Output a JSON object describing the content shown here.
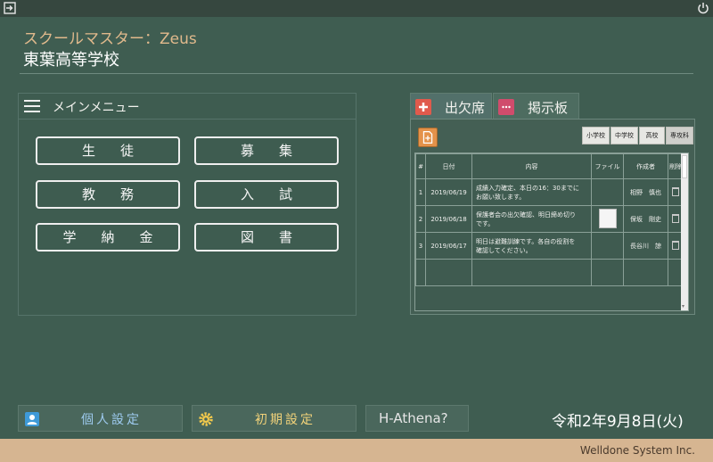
{
  "header": {
    "app_title": "スクールマスター：Zeus",
    "school_name": "東葉高等学校"
  },
  "main_menu": {
    "title": "メインメニュー",
    "buttons": [
      "生徒",
      "募集",
      "教務",
      "入試",
      "学納金",
      "図書"
    ]
  },
  "tabs": [
    {
      "label": "出欠席",
      "icon": "plus-icon",
      "color": "#e05a4c"
    },
    {
      "label": "掲示板",
      "icon": "chat-icon",
      "color": "#d04c6c"
    }
  ],
  "attendance": {
    "school_tabs": [
      "小学校",
      "中学校",
      "高校",
      "専攻科"
    ],
    "selected_tab": "専攻科",
    "columns": [
      "#",
      "日付",
      "内容",
      "ファイル",
      "作成者",
      "削除"
    ],
    "rows": [
      {
        "no": "1",
        "date": "2019/06/19",
        "content_line1": "成績入力確定、本日の16：30までに",
        "content_line2": "お願い致します。",
        "has_file": false,
        "author": "相野　慎也"
      },
      {
        "no": "2",
        "date": "2019/06/18",
        "content_line1": "保護者会の出欠確認、明日締め切り",
        "content_line2": "です。",
        "has_file": true,
        "author": "保坂　剛史"
      },
      {
        "no": "3",
        "date": "2019/06/17",
        "content_line1": "明日は避難訓練です。各自の役割を",
        "content_line2": "確認してください。",
        "has_file": false,
        "author": "長谷川　諒"
      }
    ]
  },
  "bottom": {
    "personal_settings": "個人設定",
    "initial_settings": "初期設定",
    "help": "H-Athena?",
    "date": "令和2年9月8日(火)"
  },
  "footer": {
    "company": "Welldone System Inc."
  }
}
